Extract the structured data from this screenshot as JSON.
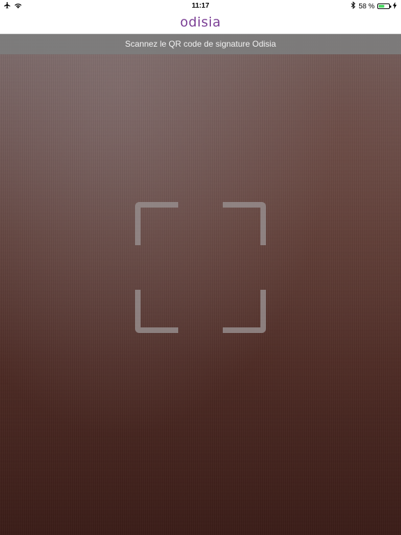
{
  "status_bar": {
    "time": "11:17",
    "battery_text": "58 %",
    "battery_level": 0.58,
    "icons": [
      "airplane-icon",
      "wifi-icon",
      "bluetooth-icon",
      "battery-icon",
      "charging-bolt-icon"
    ]
  },
  "nav": {
    "logo_text": "odisia"
  },
  "scanner": {
    "instruction": "Scannez le QR code de signature Odisia"
  },
  "colors": {
    "brand": "#7b3f95",
    "banner": "#7d7d7d",
    "battery_fill": "#4cd964",
    "frame": "#968c8c"
  }
}
